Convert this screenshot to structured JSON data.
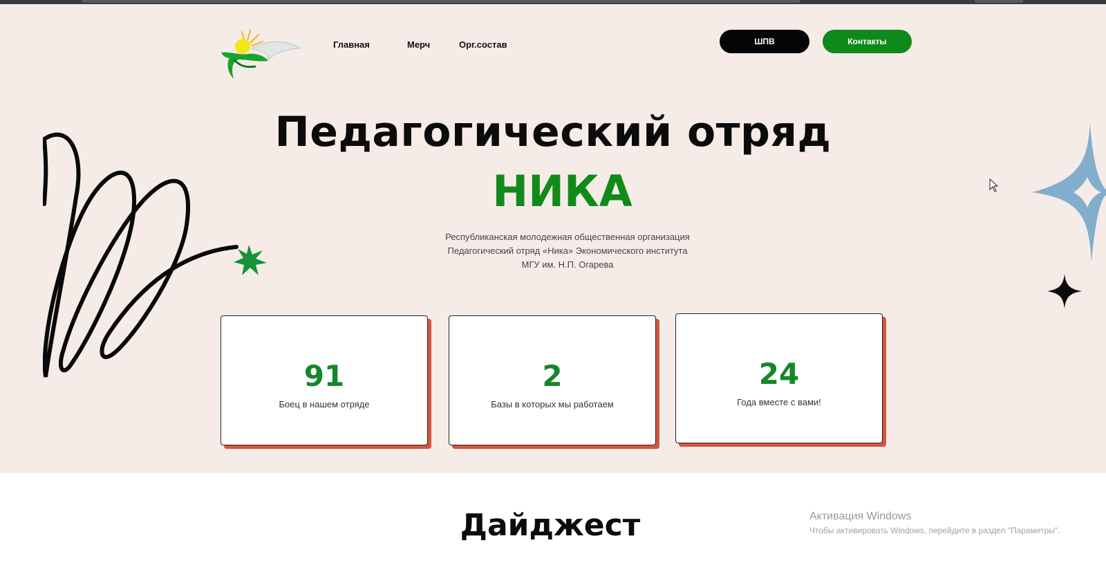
{
  "nav": {
    "links": [
      "Главная",
      "Мерч",
      "Орг.состав"
    ],
    "buttons": {
      "shpv": "ШПВ",
      "contacts": "Контакты"
    }
  },
  "hero": {
    "title": "Педагогический отряд",
    "accent": "НИКА",
    "subtitle_lines": [
      "Республиканская молодежная общественная организация",
      "Педагогический отряд «Ника» Экономического института",
      "МГУ им. Н.П. Огарева"
    ]
  },
  "stats": [
    {
      "value": "91",
      "label": "Боец в нашем отряде"
    },
    {
      "value": "2",
      "label": "Базы в которых мы работаем"
    },
    {
      "value": "24",
      "label": "Года вместе с вами!"
    }
  ],
  "digest": {
    "title": "Дайджест"
  },
  "windows_watermark": {
    "title": "Активация Windows",
    "subtitle": "Чтобы активировать Windows, перейдите в раздел \"Параметры\"."
  },
  "colors": {
    "background": "#f5ece8",
    "accent_green": "#128a1a",
    "card_shadow": "#d6553f",
    "star_blue": "#82aecd"
  },
  "icons": [
    "logo-emblem",
    "scribble-decoration",
    "green-star-icon",
    "blue-sparkle-icon",
    "black-sparkle-icon",
    "mouse-cursor-icon"
  ]
}
